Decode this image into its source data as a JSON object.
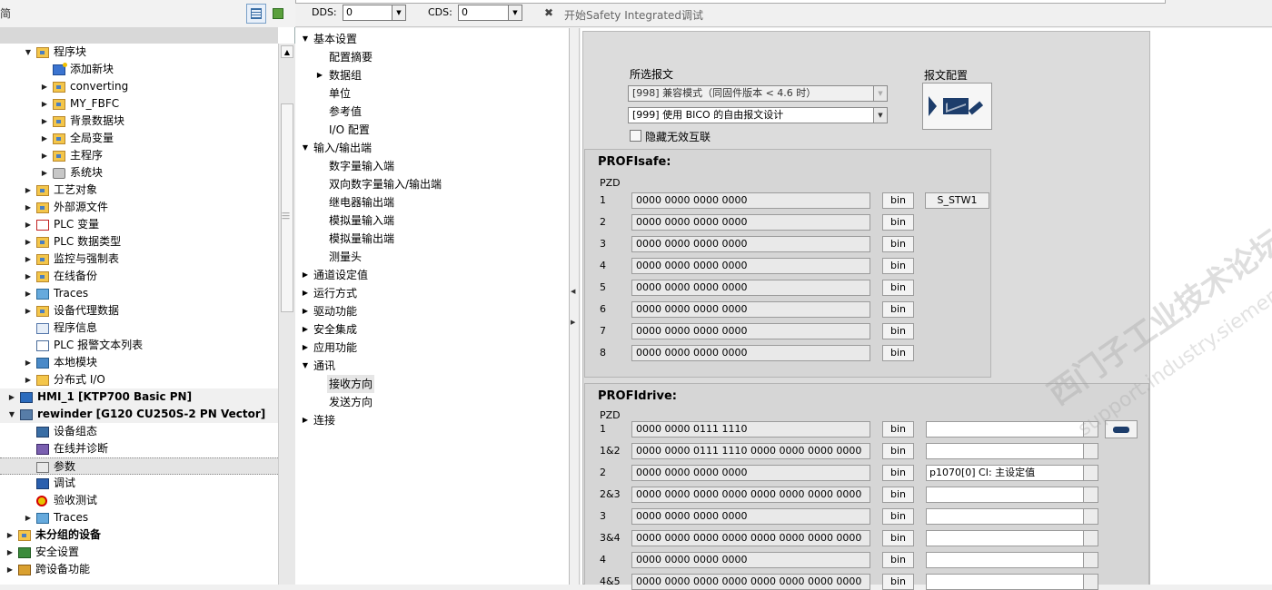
{
  "left": {
    "title_glyph": "简",
    "tree": [
      {
        "label": "程序块",
        "indent": 1,
        "arrow": "down",
        "icon": "folder"
      },
      {
        "label": "添加新块",
        "indent": 2,
        "arrow": "",
        "icon": "add"
      },
      {
        "label": "converting",
        "indent": 2,
        "arrow": "right",
        "icon": "folder"
      },
      {
        "label": "MY_FBFC",
        "indent": 2,
        "arrow": "right",
        "icon": "folder"
      },
      {
        "label": "背景数据块",
        "indent": 2,
        "arrow": "right",
        "icon": "folder"
      },
      {
        "label": "全局变量",
        "indent": 2,
        "arrow": "right",
        "icon": "folder"
      },
      {
        "label": "主程序",
        "indent": 2,
        "arrow": "right",
        "icon": "folder"
      },
      {
        "label": "系统块",
        "indent": 2,
        "arrow": "right",
        "icon": "gear"
      },
      {
        "label": "工艺对象",
        "indent": 1,
        "arrow": "right",
        "icon": "folder"
      },
      {
        "label": "外部源文件",
        "indent": 1,
        "arrow": "right",
        "icon": "folder"
      },
      {
        "label": "PLC 变量",
        "indent": 1,
        "arrow": "right",
        "icon": "plcv"
      },
      {
        "label": "PLC 数据类型",
        "indent": 1,
        "arrow": "right",
        "icon": "folder"
      },
      {
        "label": "监控与强制表",
        "indent": 1,
        "arrow": "right",
        "icon": "folder"
      },
      {
        "label": "在线备份",
        "indent": 1,
        "arrow": "right",
        "icon": "folder"
      },
      {
        "label": "Traces",
        "indent": 1,
        "arrow": "right",
        "icon": "traces"
      },
      {
        "label": "设备代理数据",
        "indent": 1,
        "arrow": "right",
        "icon": "folder"
      },
      {
        "label": "程序信息",
        "indent": 1,
        "arrow": "",
        "icon": "info"
      },
      {
        "label": "PLC 报警文本列表",
        "indent": 1,
        "arrow": "",
        "icon": "doc"
      },
      {
        "label": "本地模块",
        "indent": 1,
        "arrow": "right",
        "icon": "local"
      },
      {
        "label": "分布式 I/O",
        "indent": 1,
        "arrow": "right",
        "icon": "dist"
      },
      {
        "label": "HMI_1 [KTP700 Basic PN]",
        "indent": 0,
        "arrow": "right",
        "icon": "hmi",
        "bold": true,
        "grey": true
      },
      {
        "label": "rewinder [G120 CU250S-2 PN Vector]",
        "indent": 0,
        "arrow": "down",
        "icon": "drive",
        "bold": true,
        "grey": true
      },
      {
        "label": "设备组态",
        "indent": 1,
        "arrow": "",
        "icon": "device"
      },
      {
        "label": "在线并诊断",
        "indent": 1,
        "arrow": "",
        "icon": "online"
      },
      {
        "label": "参数",
        "indent": 1,
        "arrow": "",
        "icon": "param",
        "selected": true
      },
      {
        "label": "调试",
        "indent": 1,
        "arrow": "",
        "icon": "debug"
      },
      {
        "label": "验收测试",
        "indent": 1,
        "arrow": "",
        "icon": "check"
      },
      {
        "label": "Traces",
        "indent": 1,
        "arrow": "right",
        "icon": "traces"
      },
      {
        "label": "未分组的设备",
        "indent": -1,
        "arrow": "right",
        "icon": "folder",
        "bold": true
      },
      {
        "label": "安全设置",
        "indent": -1,
        "arrow": "right",
        "icon": "safety"
      },
      {
        "label": "跨设备功能",
        "indent": -1,
        "arrow": "right",
        "icon": "cross"
      }
    ]
  },
  "toolbar": {
    "dds_label": "DDS:",
    "dds_value": "0",
    "cds_label": "CDS:",
    "cds_value": "0",
    "safety_label": "开始Safety Integrated调试"
  },
  "nav": [
    {
      "label": "基本设置",
      "level": 0,
      "arrow": "down"
    },
    {
      "label": "配置摘要",
      "level": 1,
      "arrow": ""
    },
    {
      "label": "数据组",
      "level": 1,
      "arrow": "right"
    },
    {
      "label": "单位",
      "level": 1,
      "arrow": ""
    },
    {
      "label": "参考值",
      "level": 1,
      "arrow": ""
    },
    {
      "label": "I/O 配置",
      "level": 1,
      "arrow": ""
    },
    {
      "label": "输入/输出端",
      "level": 0,
      "arrow": "down"
    },
    {
      "label": "数字量输入端",
      "level": 1,
      "arrow": ""
    },
    {
      "label": "双向数字量输入/输出端",
      "level": 1,
      "arrow": ""
    },
    {
      "label": "继电器输出端",
      "level": 1,
      "arrow": ""
    },
    {
      "label": "模拟量输入端",
      "level": 1,
      "arrow": ""
    },
    {
      "label": "模拟量输出端",
      "level": 1,
      "arrow": ""
    },
    {
      "label": "测量头",
      "level": 1,
      "arrow": ""
    },
    {
      "label": "通道设定值",
      "level": 0,
      "arrow": "right"
    },
    {
      "label": "运行方式",
      "level": 0,
      "arrow": "right"
    },
    {
      "label": "驱动功能",
      "level": 0,
      "arrow": "right"
    },
    {
      "label": "安全集成",
      "level": 0,
      "arrow": "right"
    },
    {
      "label": "应用功能",
      "level": 0,
      "arrow": "right"
    },
    {
      "label": "通讯",
      "level": 0,
      "arrow": "down"
    },
    {
      "label": "接收方向",
      "level": 1,
      "arrow": "",
      "selected": true
    },
    {
      "label": "发送方向",
      "level": 1,
      "arrow": ""
    },
    {
      "label": "连接",
      "level": 0,
      "arrow": "right"
    }
  ],
  "panel": {
    "telegram_label": "所选报文",
    "telegram_config_label": "报文配置",
    "telegram_1": "[998] 兼容模式（同固件版本 < 4.6 时）",
    "telegram_2": "[999] 使用 BICO 的自由报文设计",
    "hide_invalid_label": "隐藏无效互联",
    "profisafe": {
      "title": "PROFIsafe:",
      "pzd_label": "PZD",
      "bin_label": "bin",
      "stw_label": "S_STW1",
      "rows": [
        {
          "n": "1",
          "value": "0000 0000 0000 0000"
        },
        {
          "n": "2",
          "value": "0000 0000 0000 0000"
        },
        {
          "n": "3",
          "value": "0000 0000 0000 0000"
        },
        {
          "n": "4",
          "value": "0000 0000 0000 0000"
        },
        {
          "n": "5",
          "value": "0000 0000 0000 0000"
        },
        {
          "n": "6",
          "value": "0000 0000 0000 0000"
        },
        {
          "n": "7",
          "value": "0000 0000 0000 0000"
        },
        {
          "n": "8",
          "value": "0000 0000 0000 0000"
        }
      ]
    },
    "profidrive": {
      "title": "PROFIdrive:",
      "pzd_label": "PZD",
      "bin_label": "bin",
      "rows": [
        {
          "n": "1",
          "value": "0000 0000 0111 1110",
          "interconnect": ""
        },
        {
          "n": "1&2",
          "value": "0000 0000 0111 1110 0000 0000 0000 0000",
          "interconnect": ""
        },
        {
          "n": "2",
          "value": "0000 0000 0000 0000",
          "interconnect": "p1070[0] CI: 主设定值"
        },
        {
          "n": "2&3",
          "value": "0000 0000 0000 0000 0000 0000 0000 0000",
          "interconnect": ""
        },
        {
          "n": "3",
          "value": "0000 0000 0000 0000",
          "interconnect": ""
        },
        {
          "n": "3&4",
          "value": "0000 0000 0000 0000 0000 0000 0000 0000",
          "interconnect": ""
        },
        {
          "n": "4",
          "value": "0000 0000 0000 0000",
          "interconnect": ""
        },
        {
          "n": "4&5",
          "value": "0000 0000 0000 0000 0000 0000 0000 0000",
          "interconnect": ""
        }
      ]
    },
    "watermark": "西门子工业技术论坛",
    "watermark2": "support.industry.siemens.com/cs"
  }
}
